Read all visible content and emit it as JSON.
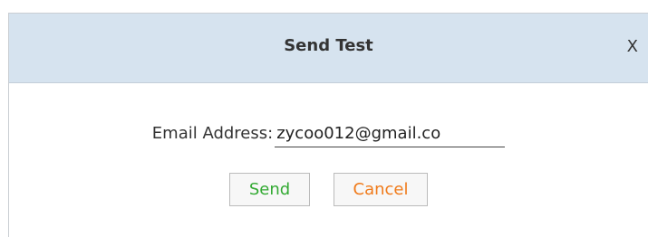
{
  "dialog": {
    "title": "Send Test",
    "close_label": "X"
  },
  "form": {
    "email_label": "Email Address:",
    "email_value": "zycoo012@gmail.co"
  },
  "buttons": {
    "send_label": "Send",
    "cancel_label": "Cancel"
  },
  "colors": {
    "titlebar_bg": "#d6e3ef",
    "send_text": "#33aa33",
    "cancel_text": "#f07b1b"
  }
}
